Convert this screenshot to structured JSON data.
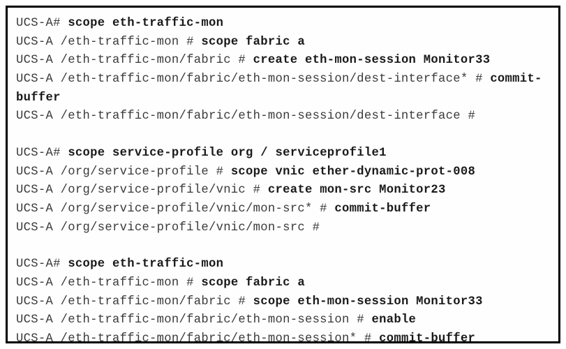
{
  "block1": {
    "l1_prompt": "UCS-A# ",
    "l1_cmd": "scope eth-traffic-mon",
    "l2_prompt": "UCS-A /eth-traffic-mon # ",
    "l2_cmd": "scope fabric a",
    "l3_prompt": "UCS-A /eth-traffic-mon/fabric # ",
    "l3_cmd": "create eth-mon-session Monitor33",
    "l4_prompt": "UCS-A /eth-traffic-mon/fabric/eth-mon-session/dest-interface* # ",
    "l4_cmd": "commit-buffer",
    "l5_prompt": "UCS-A /eth-traffic-mon/fabric/eth-mon-session/dest-interface #"
  },
  "block2": {
    "l1_prompt": "UCS-A# ",
    "l1_cmd": "scope service-profile org / serviceprofile1",
    "l2_prompt": "UCS-A /org/service-profile # ",
    "l2_cmd": "scope vnic ether-dynamic-prot-008",
    "l3_prompt": "UCS-A /org/service-profile/vnic # ",
    "l3_cmd": "create mon-src Monitor23",
    "l4_prompt": "UCS-A /org/service-profile/vnic/mon-src* # ",
    "l4_cmd": "commit-buffer",
    "l5_prompt": "UCS-A /org/service-profile/vnic/mon-src #"
  },
  "block3": {
    "l1_prompt": "UCS-A# ",
    "l1_cmd": "scope eth-traffic-mon",
    "l2_prompt": "UCS-A /eth-traffic-mon # ",
    "l2_cmd": "scope fabric a",
    "l3_prompt": "UCS-A /eth-traffic-mon/fabric # ",
    "l3_cmd": "scope eth-mon-session Monitor33",
    "l4_prompt": "UCS-A /eth-traffic-mon/fabric/eth-mon-session # ",
    "l4_cmd": "enable",
    "l5_prompt": "UCS-A /eth-traffic-mon/fabric/eth-mon-session* # ",
    "l5_cmd": "commit-buffer"
  }
}
